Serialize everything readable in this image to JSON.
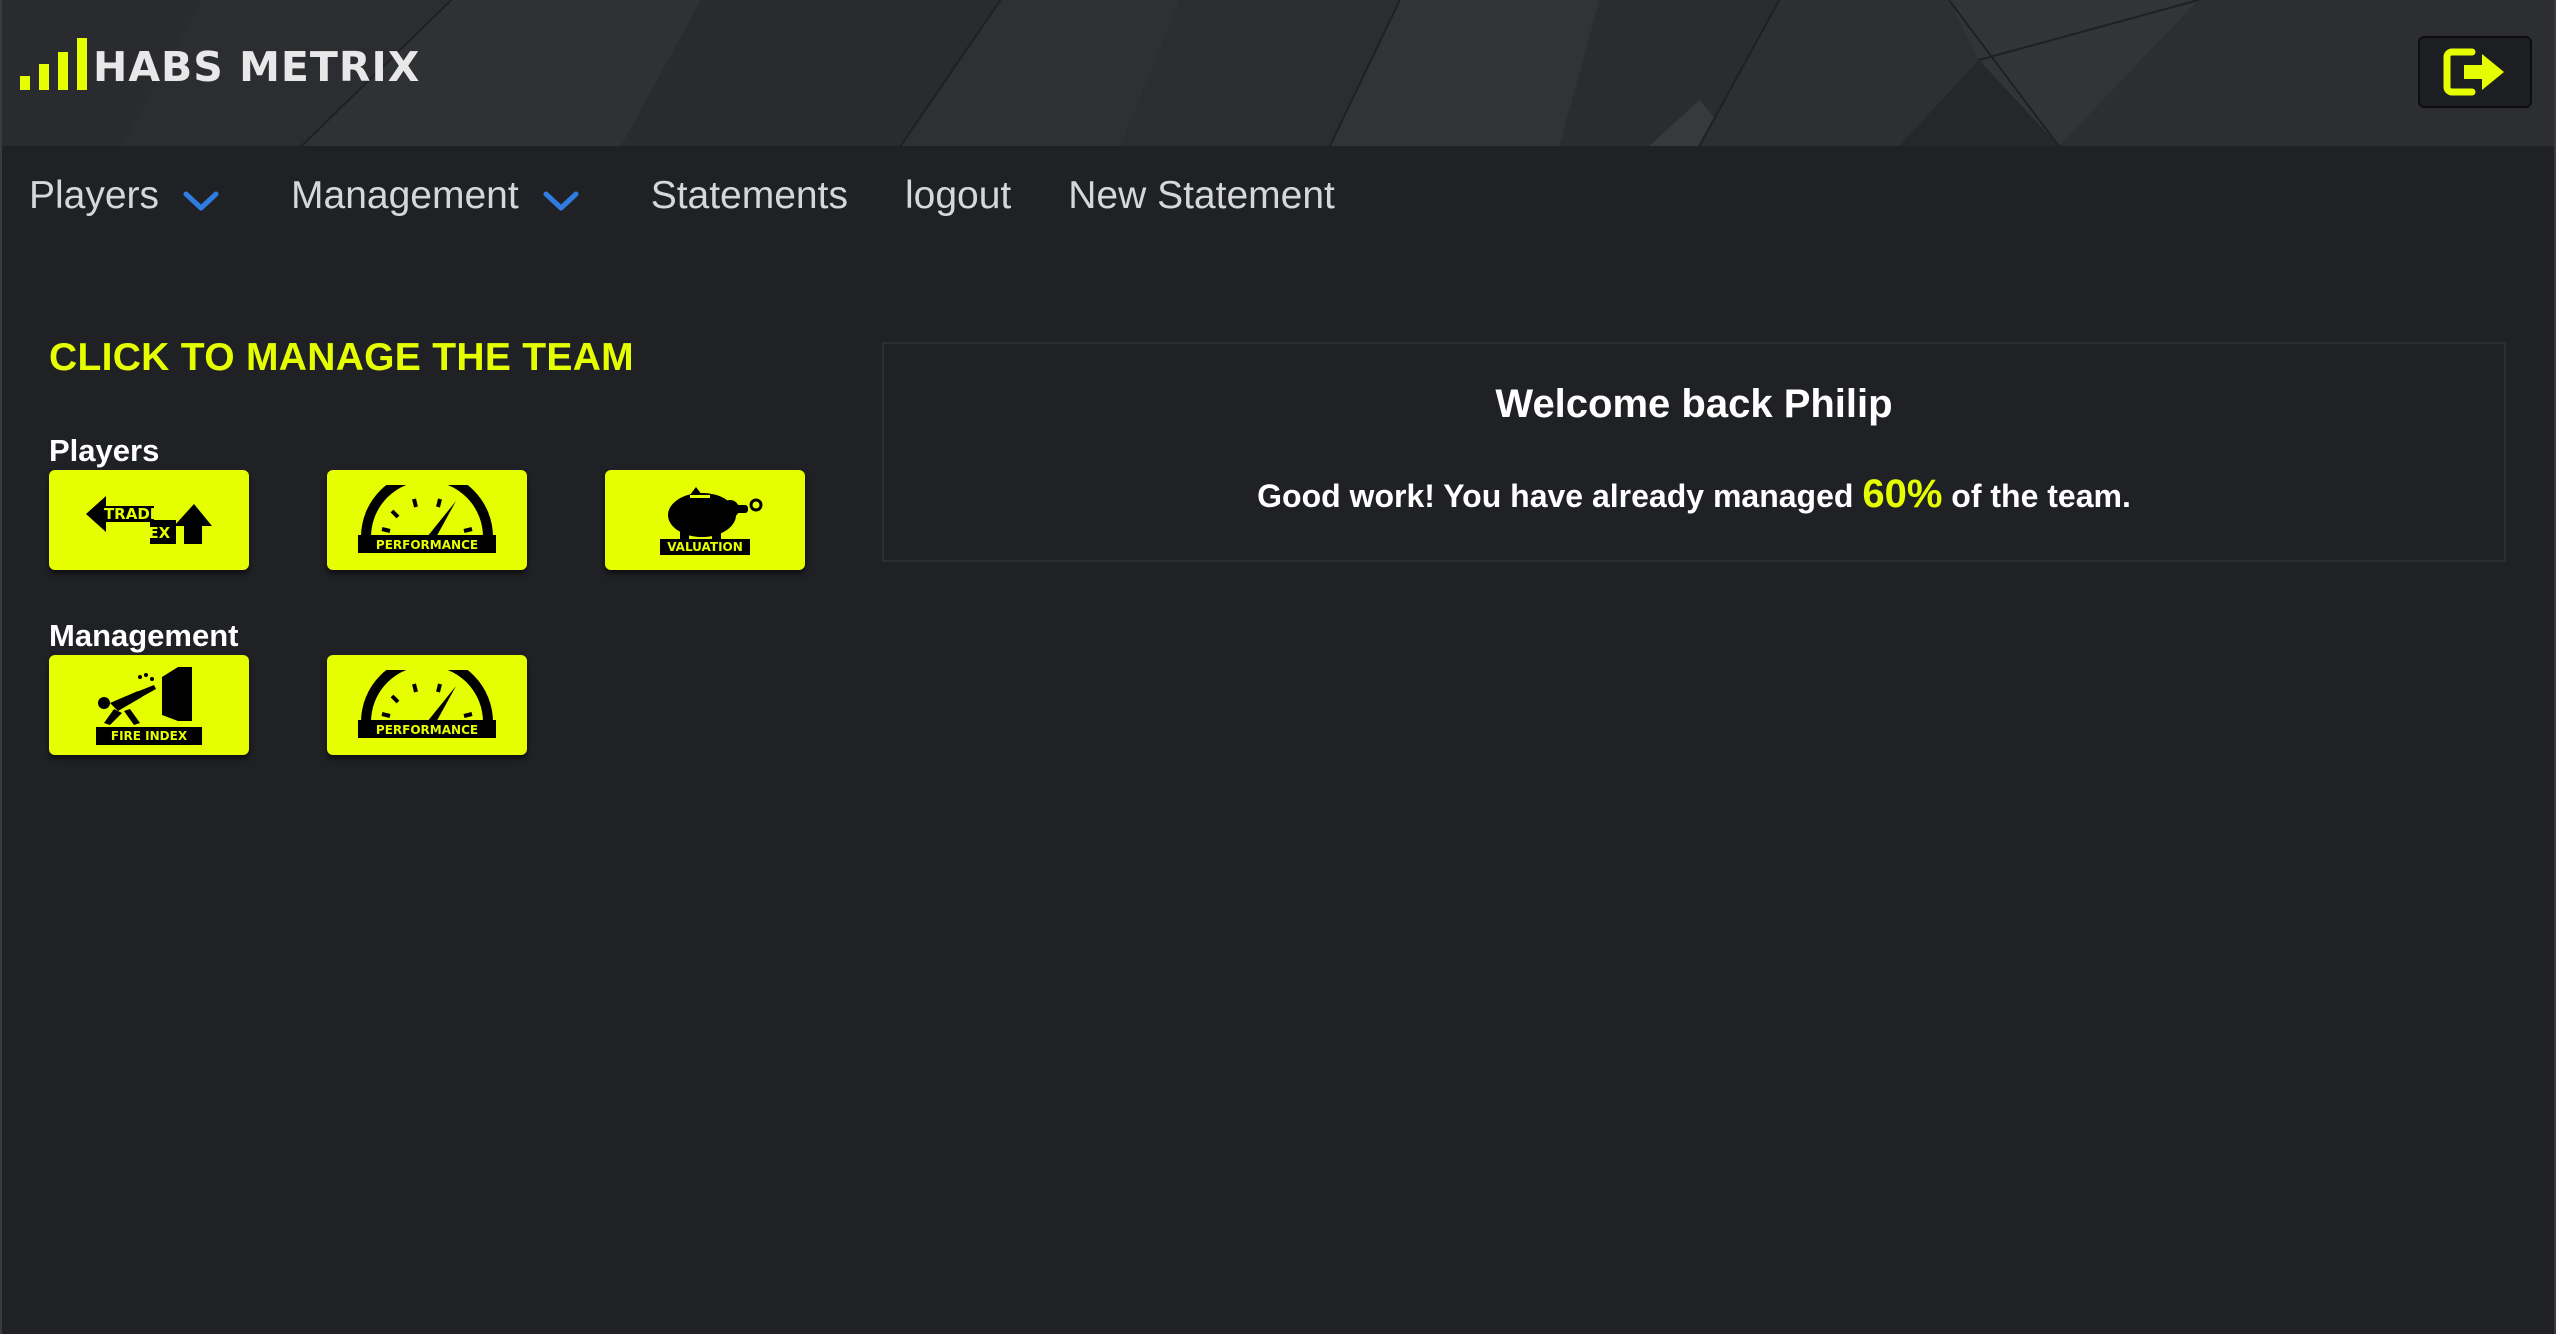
{
  "header": {
    "logo_text": "HABS METRIX",
    "logout_icon": "sign-out-icon"
  },
  "nav": {
    "items": [
      {
        "label": "Players",
        "dropdown": true
      },
      {
        "label": "Management",
        "dropdown": true
      },
      {
        "label": "Statements",
        "dropdown": false
      },
      {
        "label": "logout",
        "dropdown": false
      },
      {
        "label": "New Statement",
        "dropdown": false
      }
    ]
  },
  "main": {
    "title": "CLICK TO MANAGE THE TEAM",
    "players": {
      "label": "Players",
      "tiles": [
        {
          "icon": "trade-index-icon",
          "caption_line1": "TRADE",
          "caption_line2": "INDEX"
        },
        {
          "icon": "performance-gauge-icon",
          "caption": "PERFORMANCE"
        },
        {
          "icon": "piggy-bank-icon",
          "caption": "VALUATION"
        }
      ]
    },
    "management": {
      "label": "Management",
      "tiles": [
        {
          "icon": "fire-index-icon",
          "caption": "FIRE INDEX"
        },
        {
          "icon": "performance-gauge-icon",
          "caption": "PERFORMANCE"
        }
      ]
    }
  },
  "welcome": {
    "title": "Welcome back Philip",
    "msg_before": "Good work! You have already managed ",
    "percent": "60%",
    "msg_after": " of the team."
  },
  "colors": {
    "accent": "#e6ff00",
    "background": "#202125",
    "header_bg": "#2a2b2f",
    "chevron": "#2f7de1"
  }
}
